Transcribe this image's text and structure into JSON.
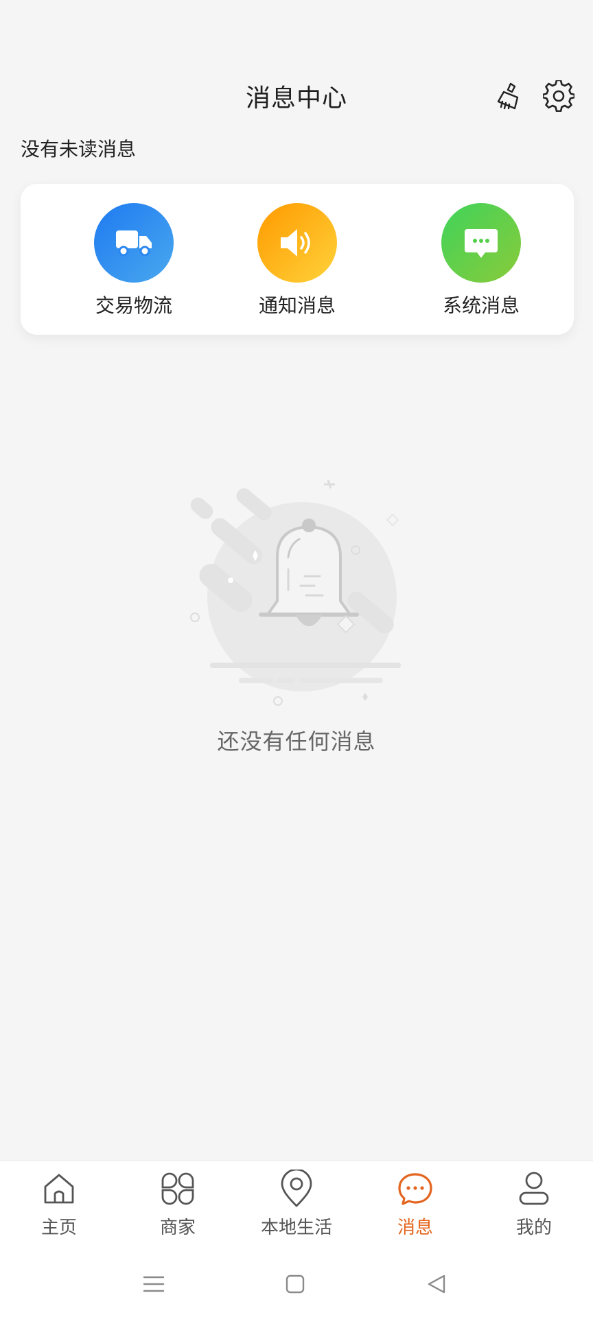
{
  "header": {
    "title": "消息中心",
    "clean_icon": "broom-icon",
    "settings_icon": "gear-icon"
  },
  "status": {
    "unread_label": "没有未读消息"
  },
  "categories": [
    {
      "label": "交易物流",
      "icon": "truck-icon",
      "color": "#2a86f0"
    },
    {
      "label": "通知消息",
      "icon": "speaker-icon",
      "color": "#ffb21a"
    },
    {
      "label": "系统消息",
      "icon": "chat-icon",
      "color": "#55cf4a"
    }
  ],
  "empty_state": {
    "icon": "bell-icon",
    "text": "还没有任何消息"
  },
  "bottom_nav": {
    "items": [
      {
        "label": "主页",
        "icon": "home-icon",
        "active": false
      },
      {
        "label": "商家",
        "icon": "grid-icon",
        "active": false
      },
      {
        "label": "本地生活",
        "icon": "location-pin-icon",
        "active": false
      },
      {
        "label": "消息",
        "icon": "chat-bubble-icon",
        "active": true
      },
      {
        "label": "我的",
        "icon": "user-icon",
        "active": false
      }
    ],
    "active_color": "#e4651f"
  },
  "system_nav": {
    "menu_icon": "menu-icon",
    "home_icon": "square-icon",
    "back_icon": "back-triangle-icon"
  }
}
